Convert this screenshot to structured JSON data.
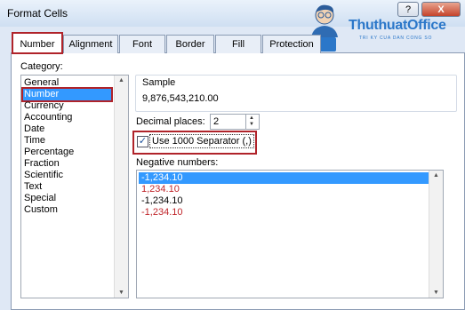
{
  "window": {
    "title": "Format Cells",
    "help_label": "?",
    "close_label": "X"
  },
  "logo": {
    "brand": "ThuthuatOffice",
    "tagline": "TRI KY CUA DAN CONG SO"
  },
  "tabs": [
    {
      "label": "Number",
      "active": true
    },
    {
      "label": "Alignment"
    },
    {
      "label": "Font"
    },
    {
      "label": "Border"
    },
    {
      "label": "Fill"
    },
    {
      "label": "Protection"
    }
  ],
  "category": {
    "label": "Category:",
    "items": [
      "General",
      "Number",
      "Currency",
      "Accounting",
      "Date",
      "Time",
      "Percentage",
      "Fraction",
      "Scientific",
      "Text",
      "Special",
      "Custom"
    ],
    "selected": "Number"
  },
  "sample": {
    "label": "Sample",
    "value": "9,876,543,210.00"
  },
  "decimal_places": {
    "label": "Decimal places:",
    "value": "2"
  },
  "separator": {
    "label": "Use 1000 Separator (,)",
    "checked": true,
    "check_glyph": "✓"
  },
  "negative_numbers": {
    "label": "Negative numbers:",
    "items": [
      {
        "text": "-1,234.10",
        "selected": true,
        "red": false
      },
      {
        "text": "1,234.10",
        "selected": false,
        "red": true
      },
      {
        "text": "-1,234.10",
        "selected": false,
        "red": false
      },
      {
        "text": "-1,234.10",
        "selected": false,
        "red": true
      }
    ]
  },
  "colors": {
    "selection": "#3399ff",
    "highlight_border": "#b0232a",
    "negative_red": "#c0262b",
    "logo_blue": "#2b77c9"
  }
}
